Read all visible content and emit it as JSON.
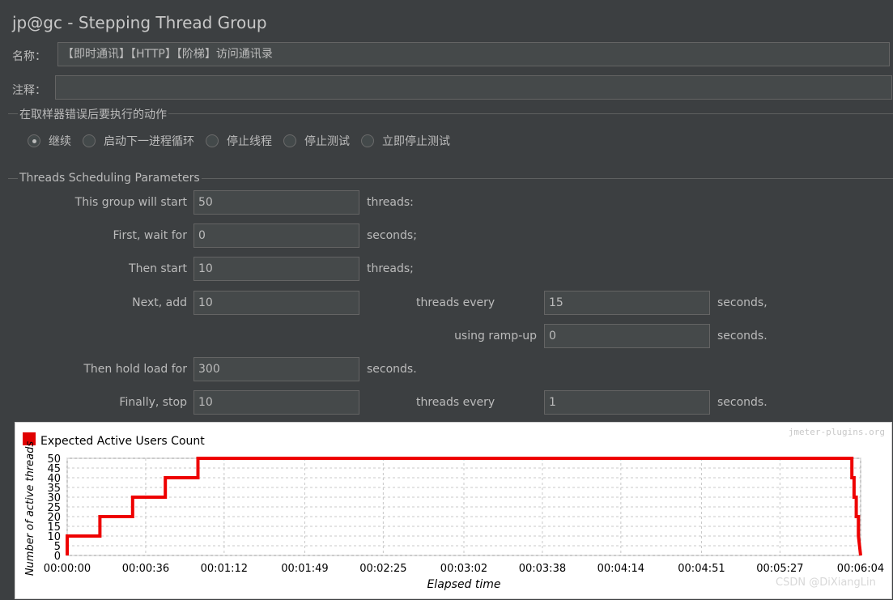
{
  "window": {
    "title": "jp@gc - Stepping Thread Group"
  },
  "name_field": {
    "label": "名称：",
    "value": "【即时通讯】【HTTP】【阶梯】访问通讯录"
  },
  "comment_field": {
    "label": "注释：",
    "value": ""
  },
  "sampler_error": {
    "section_title": "在取样器错误后要执行的动作",
    "options": [
      {
        "label": "继续",
        "selected": true
      },
      {
        "label": "启动下一进程循环",
        "selected": false
      },
      {
        "label": "停止线程",
        "selected": false
      },
      {
        "label": "停止测试",
        "selected": false
      },
      {
        "label": "立即停止测试",
        "selected": false
      }
    ]
  },
  "params": {
    "section_title": "Threads Scheduling Parameters",
    "start_label": "This group will start",
    "start_value": "50",
    "start_unit": "threads:",
    "wait_label": "First, wait for",
    "wait_value": "0",
    "wait_unit": "seconds;",
    "then_start_label": "Then start",
    "then_start_value": "10",
    "then_start_unit": "threads;",
    "next_add_label": "Next, add",
    "next_add_value": "10",
    "next_add_mid": "threads every",
    "next_add_every_value": "15",
    "next_add_unit": "seconds,",
    "rampup_label": "using ramp-up",
    "rampup_value": "0",
    "rampup_unit": "seconds.",
    "hold_label": "Then hold load for",
    "hold_value": "300",
    "hold_unit": "seconds.",
    "stop_label": "Finally, stop",
    "stop_value": "10",
    "stop_mid": "threads every",
    "stop_every_value": "1",
    "stop_unit": "seconds."
  },
  "watermark": "CSDN @DiXiangLin",
  "chart_data": {
    "type": "line",
    "title": "Expected Active Users Count",
    "credit": "jmeter-plugins.org",
    "xlabel": "Elapsed time",
    "ylabel": "Number of active threads",
    "ylim": [
      0,
      50
    ],
    "xlim": [
      0,
      364
    ],
    "y_ticks": [
      "0",
      "5",
      "10",
      "15",
      "20",
      "25",
      "30",
      "35",
      "40",
      "45",
      "50"
    ],
    "x_ticks": [
      {
        "t": 0,
        "label": "00:00:00"
      },
      {
        "t": 36,
        "label": "00:00:36"
      },
      {
        "t": 72,
        "label": "00:01:12"
      },
      {
        "t": 109,
        "label": "00:01:49"
      },
      {
        "t": 145,
        "label": "00:02:25"
      },
      {
        "t": 182,
        "label": "00:03:02"
      },
      {
        "t": 218,
        "label": "00:03:38"
      },
      {
        "t": 254,
        "label": "00:04:14"
      },
      {
        "t": 291,
        "label": "00:04:51"
      },
      {
        "t": 327,
        "label": "00:05:27"
      },
      {
        "t": 364,
        "label": "00:06:04"
      }
    ],
    "grid": true,
    "color": "#ee0000",
    "series": [
      {
        "name": "Expected Active Users Count",
        "x": [
          0,
          0,
          15,
          15,
          30,
          30,
          45,
          45,
          60,
          60,
          360,
          360,
          361,
          361,
          362,
          362,
          363,
          363,
          364
        ],
        "y": [
          0,
          10,
          10,
          20,
          20,
          30,
          30,
          40,
          40,
          50,
          50,
          40,
          40,
          30,
          30,
          20,
          20,
          10,
          0
        ]
      }
    ]
  }
}
